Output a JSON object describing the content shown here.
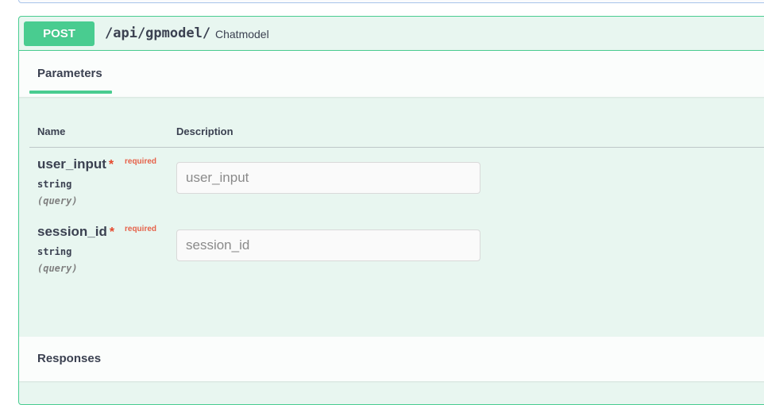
{
  "operation": {
    "method": "POST",
    "path": "/api/gpmodel/",
    "summary": "Chatmodel"
  },
  "parameters_section": {
    "title": "Parameters",
    "columns": {
      "name": "Name",
      "description": "Description"
    },
    "params": [
      {
        "name": "user_input",
        "required_mark": "*",
        "required_label": "required",
        "type": "string",
        "location": "(query)",
        "placeholder": "user_input",
        "value": ""
      },
      {
        "name": "session_id",
        "required_mark": "*",
        "required_label": "required",
        "type": "string",
        "location": "(query)",
        "placeholder": "session_id",
        "value": ""
      }
    ]
  },
  "responses_section": {
    "title": "Responses"
  },
  "colors": {
    "post_accent": "#49cc90",
    "post_background": "#e8f6f0",
    "required": "#e6482c"
  }
}
